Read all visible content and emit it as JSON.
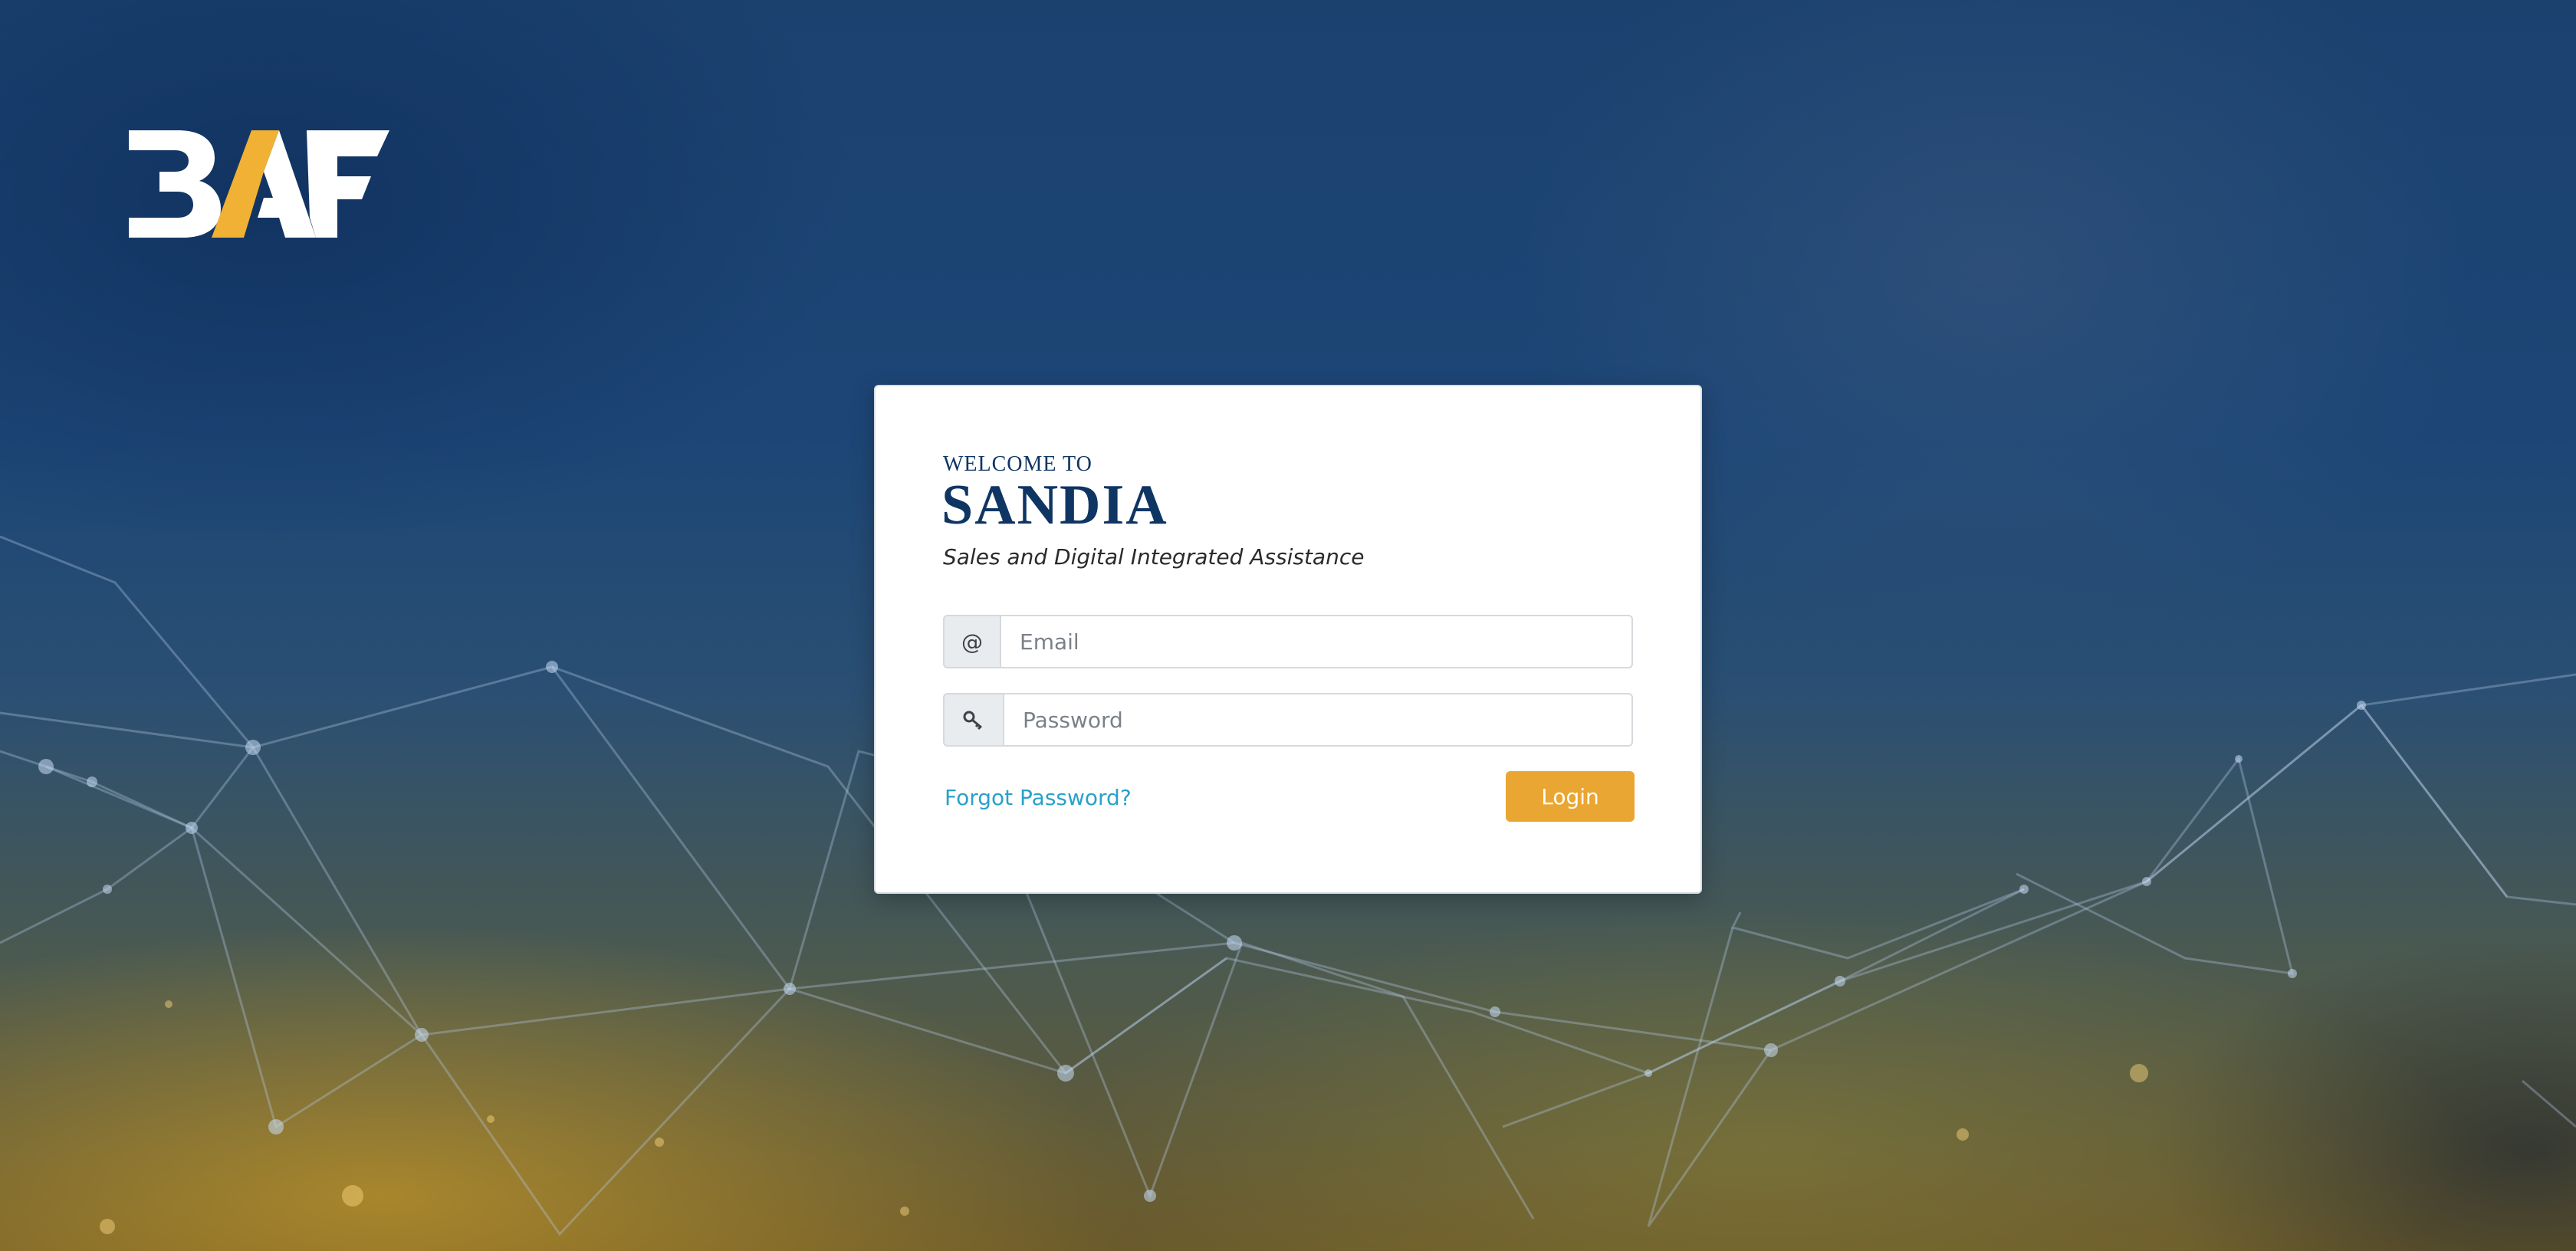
{
  "brand": {
    "logo_text": "BAF",
    "logo_colors": {
      "letters": "#ffffff",
      "accent": "#f0b135"
    }
  },
  "login_card": {
    "welcome": "WELCOME TO",
    "app_name": "SANDIA",
    "tagline": "Sales and Digital Integrated Assistance",
    "email": {
      "icon": "at-icon",
      "icon_glyph": "@",
      "placeholder": "Email",
      "value": ""
    },
    "password": {
      "icon": "key-icon",
      "placeholder": "Password",
      "value": ""
    },
    "forgot_link": "Forgot Password?",
    "login_button": "Login"
  },
  "colors": {
    "title": "#0f3563",
    "link": "#2aa1c8",
    "button": "#eaa632"
  }
}
